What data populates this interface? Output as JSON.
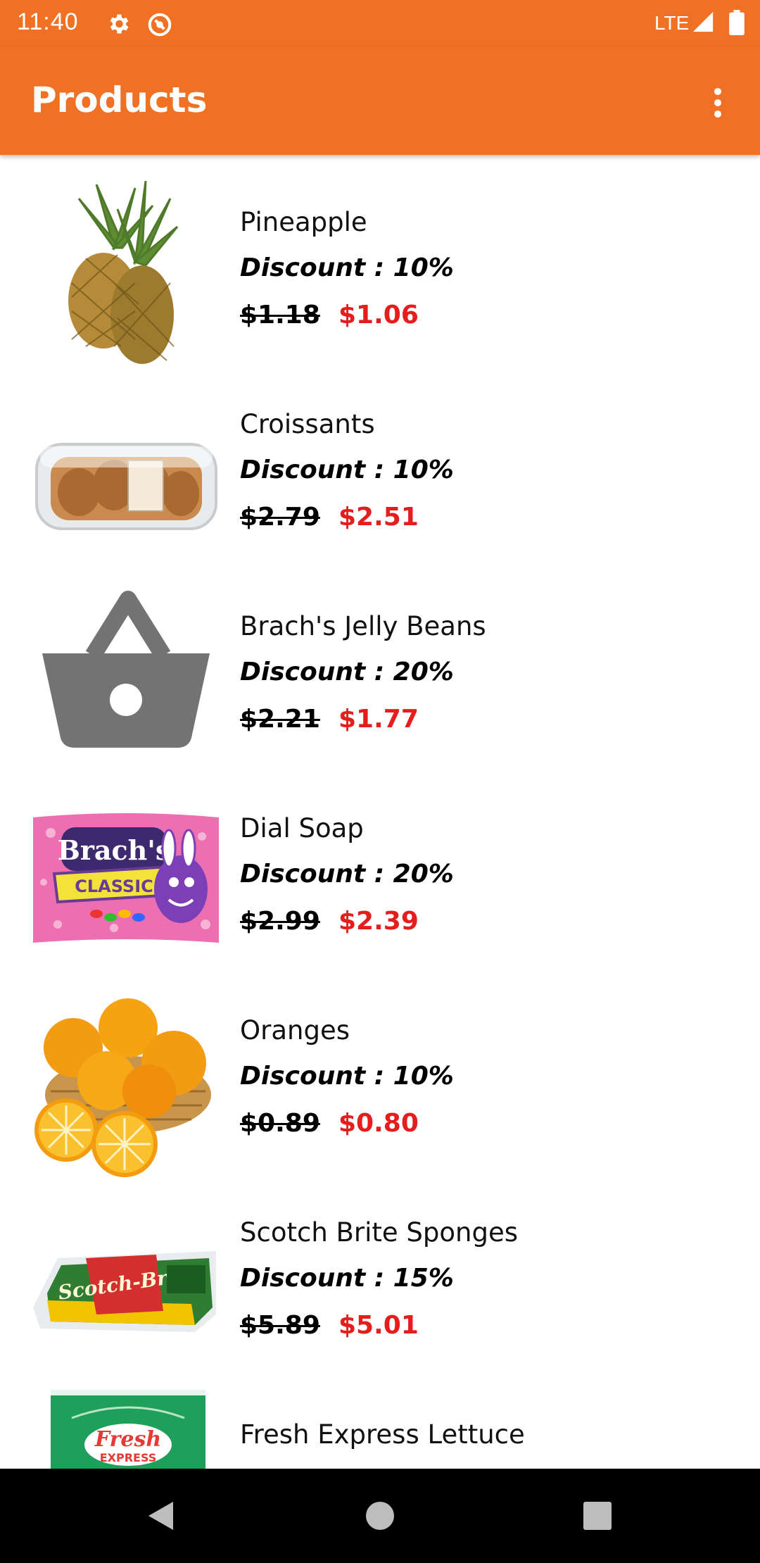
{
  "status_bar": {
    "time": "11:40",
    "network": "LTE",
    "icons": [
      "settings-icon",
      "sync-icon",
      "signal-icon",
      "battery-icon"
    ]
  },
  "app_bar": {
    "title": "Products",
    "overflow_icon": "more-vert-icon",
    "color": "#F07124"
  },
  "products": [
    {
      "name": "Pineapple",
      "discount": "Discount : 10%",
      "old_price": "$1.18",
      "new_price": "$1.06",
      "icon": "pineapple-image"
    },
    {
      "name": "Croissants",
      "discount": "Discount : 10%",
      "old_price": "$2.79",
      "new_price": "$2.51",
      "icon": "croissants-image"
    },
    {
      "name": "Brach's Jelly Beans",
      "discount": "Discount : 20%",
      "old_price": "$2.21",
      "new_price": "$1.77",
      "icon": "shopping-basket-icon"
    },
    {
      "name": "Dial Soap",
      "discount": "Discount : 20%",
      "old_price": "$2.99",
      "new_price": "$2.39",
      "icon": "jelly-beans-bag-image"
    },
    {
      "name": "Oranges",
      "discount": "Discount : 10%",
      "old_price": "$0.89",
      "new_price": "$0.80",
      "icon": "oranges-image"
    },
    {
      "name": "Scotch Brite Sponges",
      "discount": "Discount : 15%",
      "old_price": "$5.89",
      "new_price": "$5.01",
      "icon": "sponges-image"
    },
    {
      "name": "Fresh Express Lettuce",
      "icon": "lettuce-bag-image"
    }
  ],
  "image_labels": {
    "brachs_brand": "Brach's",
    "brachs_classic": "CLASSIC",
    "scotch_brite": "Scotch-Brite",
    "fresh_express_1": "Fresh",
    "fresh_express_2": "EXPRESS"
  },
  "nav_bar": {
    "buttons": [
      "back-icon",
      "home-icon",
      "recents-icon"
    ]
  },
  "colors": {
    "accent": "#F07124",
    "sale_price": "#E51D1D",
    "placeholder_icon": "#737373"
  }
}
